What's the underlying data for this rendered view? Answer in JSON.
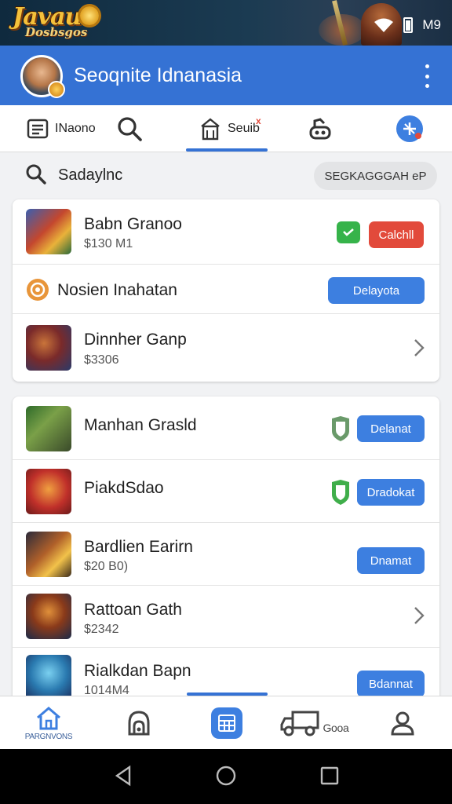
{
  "status_bar": {
    "logo_line1": "Javaua",
    "logo_line2": "Dosbsgos",
    "time": "M9",
    "icons": [
      "wifi-icon",
      "battery-icon"
    ]
  },
  "app_bar": {
    "title": "Seoqnite Idnanasia",
    "menu_icon": "more-vert-icon"
  },
  "tabs": [
    {
      "label": "INaono",
      "icon": "list-icon"
    },
    {
      "label": "",
      "icon": "search-icon"
    },
    {
      "label": "Seuib",
      "icon": "store-icon",
      "active": true,
      "badge": "x"
    },
    {
      "label": "",
      "icon": "robot-icon"
    },
    {
      "label": "",
      "icon": "compass-icon"
    }
  ],
  "search": {
    "query": "Sadaylnc",
    "button": "SEGKAGGGAH eP"
  },
  "card1": {
    "rows": [
      {
        "title": "Babn Granoo",
        "subtitle": "$130 M1",
        "action": "Calchll",
        "status": "check"
      },
      {
        "title": "Nosien Inahatan",
        "action": "Delayota"
      },
      {
        "title": "Dinnher Ganp",
        "subtitle": "$3306"
      }
    ]
  },
  "card2": {
    "rows": [
      {
        "title": "Manhan Grasld",
        "action": "Delanat"
      },
      {
        "title": "PiakdSdao",
        "action": "Dradokat"
      },
      {
        "title": "Bardlien Earirn",
        "subtitle": "$20 B0)",
        "action": "Dnamat"
      },
      {
        "title": "Rattoan Gath",
        "subtitle": "$2342"
      },
      {
        "title": "Rialkdan Bapn",
        "subtitle": "1014M4",
        "action": "Bdannat"
      }
    ]
  },
  "bottom_nav": [
    {
      "label": "PARGNVONS",
      "icon": "home-icon"
    },
    {
      "label": "",
      "icon": "lock-icon"
    },
    {
      "label": "",
      "icon": "grid-icon",
      "active": true
    },
    {
      "label": "Gooa",
      "icon": "truck-icon"
    },
    {
      "label": "",
      "icon": "person-icon"
    }
  ],
  "colors": {
    "primary": "#3572d4",
    "button_blue": "#3d7fe0",
    "button_red": "#e24a3b",
    "check_green": "#36b34a"
  }
}
